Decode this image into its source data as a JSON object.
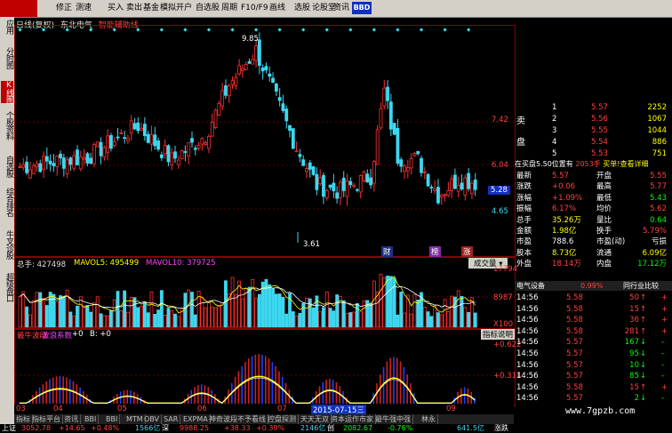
{
  "toolbar": {
    "items": [
      "修正",
      "测速",
      "买入",
      "卖出",
      "基金",
      "模拟",
      "开户",
      "自选股",
      "周期",
      "F10/F9",
      "画线",
      "选股",
      "论股堂",
      "资讯"
    ],
    "bbd_label": "BBD"
  },
  "left_tabs": [
    {
      "label": "应用",
      "active": false
    },
    {
      "label": "分时图",
      "active": false
    },
    {
      "label": "K线图",
      "active": true
    },
    {
      "label": "个股资料",
      "active": false
    },
    {
      "label": "自选股",
      "active": false
    },
    {
      "label": "综合排名",
      "active": false
    },
    {
      "label": "牛叉诊股",
      "active": false
    },
    {
      "label": "超级盘口",
      "active": false
    }
  ],
  "chart_header": {
    "period": "日线(复权)",
    "stock": "东北电气",
    "indicator": "智能辅助线"
  },
  "main_chart": {
    "high_label": "9.85",
    "low_label": "3.61",
    "price_axis": [
      "7.42",
      "6.04",
      "5.28",
      "4.65"
    ],
    "current_price_tag": "5.28",
    "event_tags": [
      "财",
      "榜",
      "涨"
    ]
  },
  "volume_chart": {
    "total_label": "总手: 427498",
    "mavol5_label": "MAVOL5: 495499",
    "mavol10_label": "MAVOL10: 379725",
    "dropdown": "成交量",
    "axis": [
      "17794",
      "8987",
      "X100"
    ]
  },
  "indicator_chart": {
    "title": "最牛波段",
    "subtitle": "波浪系数",
    "a_label": "+0",
    "b_label": "B: +0",
    "button": "指标说明",
    "axis": [
      "+0.622",
      "+0.314"
    ]
  },
  "date_axis": [
    "03",
    "04",
    "05",
    "06",
    "07",
    "2015-07-15三",
    "09"
  ],
  "right_panel": {
    "sell_label": "卖",
    "sell_label2": "盘",
    "sells": [
      {
        "lvl": "1",
        "price": "5.57",
        "vol": "2252"
      },
      {
        "lvl": "2",
        "price": "5.56",
        "vol": "1067"
      },
      {
        "lvl": "3",
        "price": "5.55",
        "vol": "1044"
      },
      {
        "lvl": "4",
        "price": "5.54",
        "vol": "886"
      },
      {
        "lvl": "5",
        "price": "5.53",
        "vol": "751"
      }
    ],
    "order_line": "在买盘5.50位置有",
    "order_vol": "2053手",
    "order_action": "买单!查看详细",
    "quotes": [
      {
        "k1": "最新",
        "v1": "5.57",
        "k2": "开盘",
        "v2": "5.55"
      },
      {
        "k1": "涨跌",
        "v1": "+0.06",
        "k2": "最高",
        "v2": "5.77"
      },
      {
        "k1": "涨幅",
        "v1": "+1.09%",
        "k2": "最低",
        "v2": "5.43"
      },
      {
        "k1": "振幅",
        "v1": "6.17%",
        "k2": "均价",
        "v2": "5.62"
      },
      {
        "k1": "总手",
        "v1": "35.26万",
        "k2": "量比",
        "v2": "0.64"
      },
      {
        "k1": "金额",
        "v1": "1.98亿",
        "k2": "换手",
        "v2": "5.79%"
      },
      {
        "k1": "市盈",
        "v1": "788.6",
        "k2": "市盈(动)",
        "v2": "亏损"
      },
      {
        "k1": "股本",
        "v1": "8.73亿",
        "k2": "流通",
        "v2": "6.09亿"
      },
      {
        "k1": "外盘",
        "v1": "18.14万",
        "k2": "内盘",
        "v2": "17.12万"
      }
    ],
    "mid_tabs": {
      "left": "电气设备",
      "pct": "0.99%",
      "right": "同行业比较"
    },
    "trades": [
      {
        "time": "14:56",
        "price": "5.58",
        "vol": "50",
        "dir": "up",
        "flag": "+"
      },
      {
        "time": "14:56",
        "price": "5.58",
        "vol": "15",
        "dir": "up",
        "flag": "+"
      },
      {
        "time": "14:56",
        "price": "5.58",
        "vol": "36",
        "dir": "up",
        "flag": "+"
      },
      {
        "time": "14:56",
        "price": "5.58",
        "vol": "281",
        "dir": "up",
        "flag": "+"
      },
      {
        "time": "14:56",
        "price": "5.57",
        "vol": "167",
        "dir": "down",
        "flag": "-"
      },
      {
        "time": "14:56",
        "price": "5.57",
        "vol": "95",
        "dir": "down",
        "flag": "-"
      },
      {
        "time": "14:56",
        "price": "5.57",
        "vol": "10",
        "dir": "down",
        "flag": "-"
      },
      {
        "time": "14:56",
        "price": "5.57",
        "vol": "85",
        "dir": "down",
        "flag": "-"
      },
      {
        "time": "14:56",
        "price": "5.58",
        "vol": "15",
        "dir": "up",
        "flag": "+"
      },
      {
        "time": "14:56",
        "price": "5.57",
        "vol": "2",
        "dir": "down",
        "flag": "-"
      }
    ]
  },
  "bottom_tabs": [
    "指标",
    "指标平台",
    "资讯",
    "BBI",
    "BBI",
    "MTM",
    "OBV",
    "SAR",
    "EXPMA",
    "神奇波段不予看线",
    "控盘探测",
    "天天无双",
    "资本运作市家",
    "最牛强中强",
    "林永"
  ],
  "status_bar": {
    "sh_label": "上证",
    "sh_value": "3052.78",
    "sh_change": "+14.65",
    "sh_pct": "+0.48%",
    "sh_amount": "1566亿",
    "sz_label": "深",
    "sz_value": "9988.25",
    "sz_change": "+38.33",
    "sz_pct": "+0.39%",
    "sz_amount": "2146亿",
    "cy_label": "创",
    "cy_value": "2082.67",
    "cy_change": "-0.76%",
    "cy_amount": "641.5亿",
    "ticker": "涨跌"
  },
  "watermark": "www.7gpzb.com",
  "colors": {
    "up": "#ff3030",
    "down": "#3cd8f0",
    "ma": "#ffff00",
    "border": "#8b0000",
    "green": "#00ff00"
  }
}
